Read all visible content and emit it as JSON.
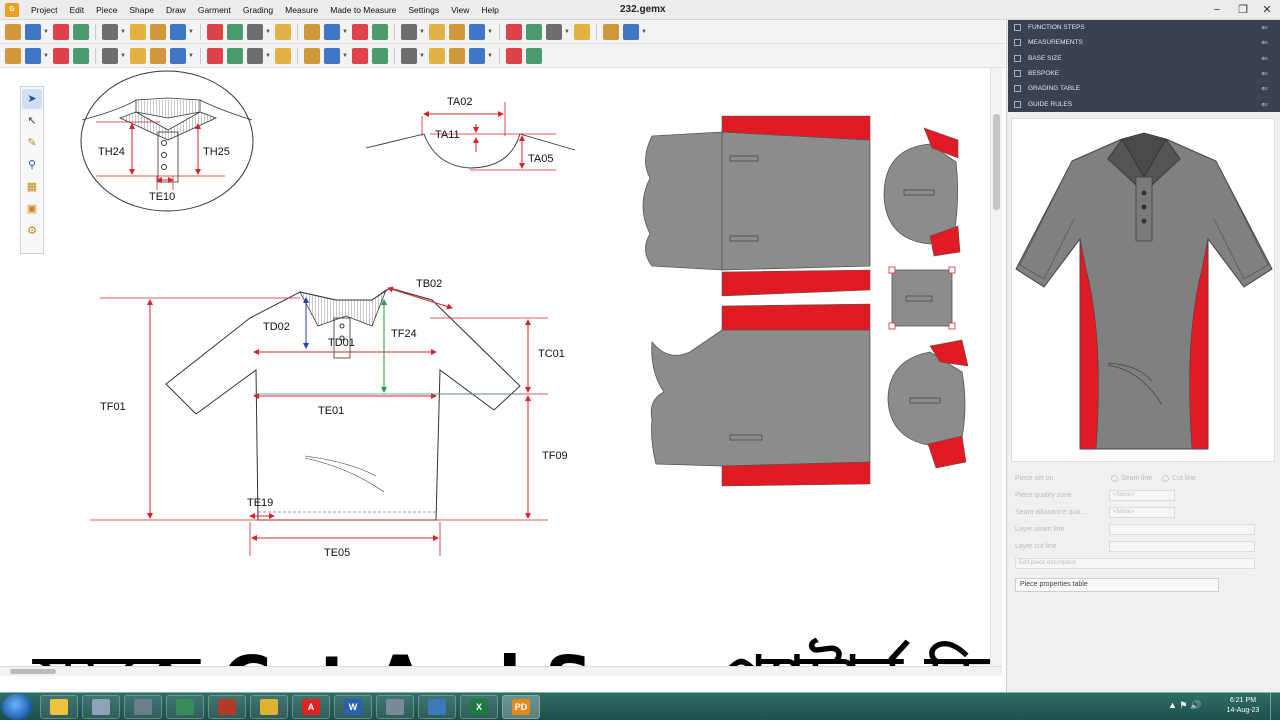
{
  "window": {
    "title": "232.gemx",
    "minimize": "−",
    "restore": "❐",
    "close": "✕"
  },
  "menu": [
    "Project",
    "Edit",
    "Piece",
    "Shape",
    "Draw",
    "Garment",
    "Grading",
    "Measure",
    "Made to Measure",
    "Settings",
    "View",
    "Help"
  ],
  "toolbar1": [
    "new",
    "open",
    "save",
    "print",
    "undo",
    "redo",
    "zoom-fit",
    "zoom-in",
    "zoom-out",
    "text",
    "piece",
    "copy",
    "paste",
    "move",
    "mirror",
    "grid",
    "view",
    "snap",
    "select-all",
    "grade",
    "measure",
    "ruler",
    "table",
    "export",
    "plot",
    "help"
  ],
  "toolbar2": [
    "piece-new",
    "piece-list",
    "cut",
    "color",
    "grade-rule",
    "rotate",
    "shape-a",
    "shape-b",
    "shape-c",
    "flip",
    "align",
    "notch",
    "drill",
    "seam",
    "pleat",
    "dart",
    "walk",
    "fold",
    "slash",
    "spread",
    "match",
    "layer"
  ],
  "palette": [
    "select-tool",
    "point-tool",
    "edit-tool",
    "measure-tool",
    "piece-tool",
    "layout-tool",
    "notch-tool"
  ],
  "labels": {
    "collar": {
      "th24": "TH24",
      "th25": "TH25",
      "te10": "TE10"
    },
    "neck": {
      "ta02": "TA02",
      "ta11": "TA11",
      "ta05": "TA05"
    },
    "body": {
      "tb02": "TB02",
      "td02": "TD02",
      "td01": "TD01",
      "tf24": "TF24",
      "tc01": "TC01",
      "tf01": "TF01",
      "te01": "TE01",
      "tf09": "TF09",
      "te19": "TE19",
      "te05": "TE05"
    }
  },
  "panel": {
    "rows": [
      "FUNCTION STEPS",
      "MEASUREMENTS",
      "BASE SIZE",
      "BESPOKE",
      "GRADING TABLE",
      "GUIDE RULES"
    ],
    "pin": "⇐"
  },
  "properties": {
    "piece_set_on": "Piece set on",
    "seam_line": "Seam line",
    "cut_line": "Cut line",
    "quality_zone": "Piece quality zone",
    "quality_zone_value": "<None>",
    "seam_allowance": "Seam allowance qua...",
    "seam_allowance_value": "<None>",
    "layer_seam": "Layer seam line",
    "layer_cut": "Layer cut line",
    "description_placeholder": "Edit piece description",
    "button": "Piece properties table"
  },
  "headline": "সহজে Cut And Sew প্যাটার্ন ডিজাইন",
  "colors": {
    "accent_red": "#e01b24",
    "piece_grey": "#8c8c8c",
    "dimension_red": "#d8232a",
    "dimension_blue": "#2a3fb0",
    "dimension_green": "#1f9a3a",
    "panel_dark": "#3a4150",
    "taskbar": "#1d4f4a"
  },
  "taskbar": {
    "apps": [
      "explorer",
      "file-manager",
      "printer",
      "paint",
      "dosbox",
      "chrome",
      "acrobat",
      "word",
      "calculator",
      "photos",
      "excel",
      "gemini"
    ],
    "time": "6:21 PM",
    "date": "14-Aug-23"
  }
}
